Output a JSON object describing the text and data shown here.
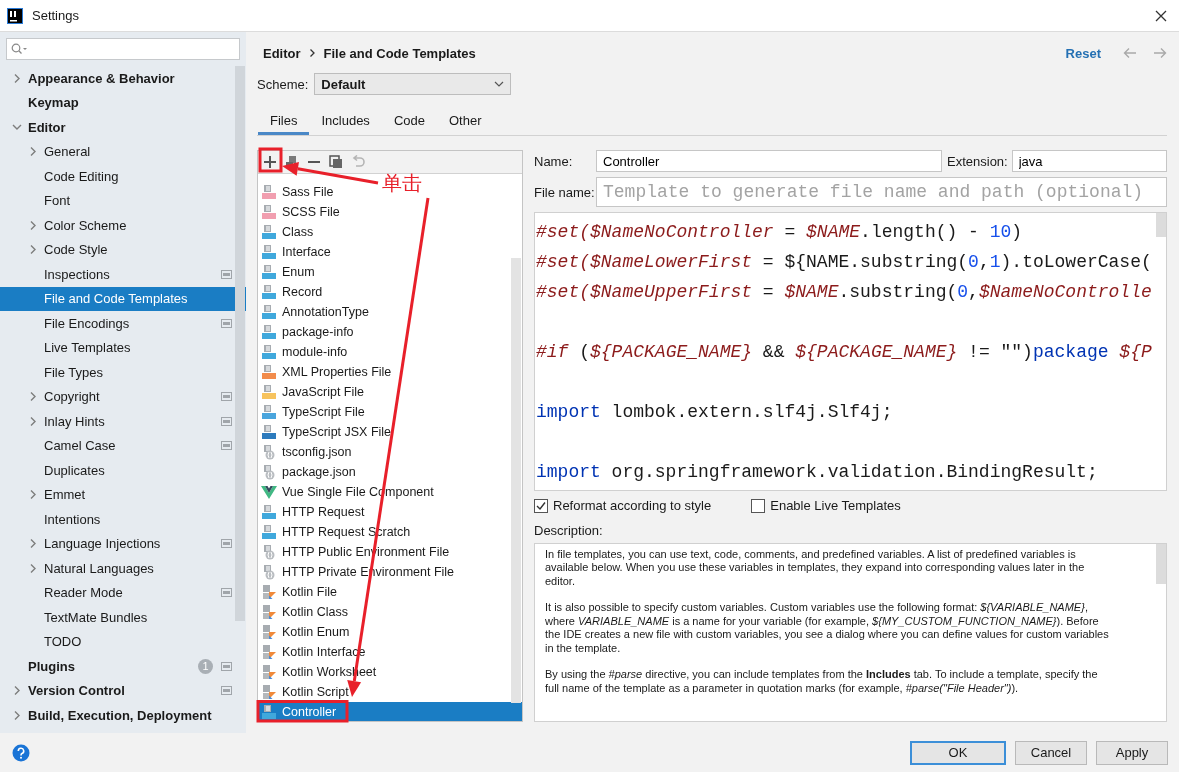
{
  "window": {
    "title": "Settings"
  },
  "sidebar": {
    "items": [
      {
        "label": "Appearance & Behavior",
        "kind": "group",
        "expanded": false,
        "selected": false
      },
      {
        "label": "Keymap",
        "kind": "leaf",
        "selected": false
      },
      {
        "label": "Editor",
        "kind": "group",
        "expanded": true,
        "selected": false,
        "children": [
          {
            "label": "General",
            "kind": "group",
            "expanded": false,
            "selected": false
          },
          {
            "label": "Code Editing",
            "kind": "leaf",
            "selected": false
          },
          {
            "label": "Font",
            "kind": "leaf",
            "selected": false
          },
          {
            "label": "Color Scheme",
            "kind": "group",
            "expanded": false,
            "selected": false
          },
          {
            "label": "Code Style",
            "kind": "group",
            "expanded": false,
            "selected": false
          },
          {
            "label": "Inspections",
            "kind": "leaf",
            "selected": false,
            "project_level": true
          },
          {
            "label": "File and Code Templates",
            "kind": "leaf",
            "selected": true
          },
          {
            "label": "File Encodings",
            "kind": "leaf",
            "selected": false,
            "project_level": true
          },
          {
            "label": "Live Templates",
            "kind": "leaf",
            "selected": false
          },
          {
            "label": "File Types",
            "kind": "leaf",
            "selected": false
          },
          {
            "label": "Copyright",
            "kind": "group",
            "expanded": false,
            "selected": false,
            "project_level": true
          },
          {
            "label": "Inlay Hints",
            "kind": "group",
            "expanded": false,
            "selected": false,
            "project_level": true
          },
          {
            "label": "Camel Case",
            "kind": "leaf",
            "selected": false,
            "project_level": true
          },
          {
            "label": "Duplicates",
            "kind": "leaf",
            "selected": false
          },
          {
            "label": "Emmet",
            "kind": "group",
            "expanded": false,
            "selected": false
          },
          {
            "label": "Intentions",
            "kind": "leaf",
            "selected": false
          },
          {
            "label": "Language Injections",
            "kind": "group",
            "expanded": false,
            "selected": false,
            "project_level": true
          },
          {
            "label": "Natural Languages",
            "kind": "group",
            "expanded": false,
            "selected": false
          },
          {
            "label": "Reader Mode",
            "kind": "leaf",
            "selected": false,
            "project_level": true
          },
          {
            "label": "TextMate Bundles",
            "kind": "leaf",
            "selected": false
          },
          {
            "label": "TODO",
            "kind": "leaf",
            "selected": false
          }
        ]
      },
      {
        "label": "Plugins",
        "kind": "leaf",
        "selected": false,
        "project_level": true,
        "badge": "1"
      },
      {
        "label": "Version Control",
        "kind": "group",
        "expanded": false,
        "selected": false,
        "project_level": true
      },
      {
        "label": "Build, Execution, Deployment",
        "kind": "group",
        "expanded": false,
        "selected": false
      }
    ]
  },
  "breadcrumb": [
    "Editor",
    "File and Code Templates"
  ],
  "reset_link": "Reset",
  "scheme": {
    "label": "Scheme:",
    "value": "Default"
  },
  "tabs": [
    {
      "label": "Files",
      "selected": true
    },
    {
      "label": "Includes",
      "selected": false
    },
    {
      "label": "Code",
      "selected": false
    },
    {
      "label": "Other",
      "selected": false
    }
  ],
  "templates": [
    {
      "name": "Sass File",
      "kind": "sass",
      "selected": false
    },
    {
      "name": "SCSS File",
      "kind": "sass",
      "selected": false
    },
    {
      "name": "Class",
      "kind": "java",
      "selected": false
    },
    {
      "name": "Interface",
      "kind": "java",
      "selected": false
    },
    {
      "name": "Enum",
      "kind": "java",
      "selected": false
    },
    {
      "name": "Record",
      "kind": "java",
      "selected": false
    },
    {
      "name": "AnnotationType",
      "kind": "java",
      "selected": false
    },
    {
      "name": "package-info",
      "kind": "java",
      "selected": false
    },
    {
      "name": "module-info",
      "kind": "java",
      "selected": false
    },
    {
      "name": "XML Properties File",
      "kind": "xml",
      "selected": false
    },
    {
      "name": "JavaScript File",
      "kind": "js",
      "selected": false
    },
    {
      "name": "TypeScript File",
      "kind": "ts",
      "selected": false
    },
    {
      "name": "TypeScript JSX File",
      "kind": "tsx",
      "selected": false
    },
    {
      "name": "tsconfig.json",
      "kind": "json",
      "selected": false
    },
    {
      "name": "package.json",
      "kind": "json",
      "selected": false
    },
    {
      "name": "Vue Single File Component",
      "kind": "vue",
      "selected": false
    },
    {
      "name": "HTTP Request",
      "kind": "api",
      "selected": false
    },
    {
      "name": "HTTP Request Scratch",
      "kind": "api",
      "selected": false
    },
    {
      "name": "HTTP Public Environment File",
      "kind": "json",
      "selected": false
    },
    {
      "name": "HTTP Private Environment File",
      "kind": "json",
      "selected": false
    },
    {
      "name": "Kotlin File",
      "kind": "kotlin",
      "selected": false
    },
    {
      "name": "Kotlin Class",
      "kind": "kotlin",
      "selected": false
    },
    {
      "name": "Kotlin Enum",
      "kind": "kotlin",
      "selected": false
    },
    {
      "name": "Kotlin Interface",
      "kind": "kotlin",
      "selected": false
    },
    {
      "name": "Kotlin Worksheet",
      "kind": "kotlin",
      "selected": false
    },
    {
      "name": "Kotlin Script",
      "kind": "kotlin",
      "selected": false
    },
    {
      "name": "Controller",
      "kind": "java",
      "selected": true
    }
  ],
  "form": {
    "name": {
      "label": "Name:",
      "value": "Controller"
    },
    "extension": {
      "label": "Extension:",
      "value": "java"
    },
    "file_name": {
      "label": "File name:",
      "placeholder": "Template to generate file name and path (optional)"
    }
  },
  "code_lines": [
    {
      "kind": "code",
      "segments": [
        {
          "kind": "directive",
          "text": "#set("
        },
        {
          "kind": "variable",
          "text": "$NameNoController"
        },
        {
          "kind": "plain",
          "text": " = "
        },
        {
          "kind": "variable",
          "text": "$NAME"
        },
        {
          "kind": "plain",
          "text": ".length() - "
        },
        {
          "kind": "number",
          "text": "10"
        },
        {
          "kind": "plain",
          "text": ")"
        }
      ]
    },
    {
      "kind": "code",
      "segments": [
        {
          "kind": "directive",
          "text": "#set("
        },
        {
          "kind": "variable",
          "text": "$NameLowerFirst"
        },
        {
          "kind": "plain",
          "text": " = ${NAME.substring("
        },
        {
          "kind": "number",
          "text": "0"
        },
        {
          "kind": "plain",
          "text": ","
        },
        {
          "kind": "number",
          "text": "1"
        },
        {
          "kind": "plain",
          "text": ").toLowerCase("
        }
      ]
    },
    {
      "kind": "code",
      "segments": [
        {
          "kind": "directive",
          "text": "#set("
        },
        {
          "kind": "variable",
          "text": "$NameUpperFirst"
        },
        {
          "kind": "plain",
          "text": " = "
        },
        {
          "kind": "variable",
          "text": "$NAME"
        },
        {
          "kind": "plain",
          "text": ".substring("
        },
        {
          "kind": "number",
          "text": "0"
        },
        {
          "kind": "plain",
          "text": ","
        },
        {
          "kind": "variable",
          "text": "$NameNoControlle"
        }
      ]
    },
    {
      "kind": "blank"
    },
    {
      "kind": "code",
      "segments": [
        {
          "kind": "directive",
          "text": "#if"
        },
        {
          "kind": "plain",
          "text": " ("
        },
        {
          "kind": "variable",
          "text": "${PACKAGE_NAME}"
        },
        {
          "kind": "plain",
          "text": " && "
        },
        {
          "kind": "variable",
          "text": "${PACKAGE_NAME}"
        },
        {
          "kind": "plain",
          "text": " != \"\")"
        },
        {
          "kind": "keyword",
          "text": "package"
        },
        {
          "kind": "variable",
          "text": " ${P"
        }
      ]
    },
    {
      "kind": "blank"
    },
    {
      "kind": "code",
      "segments": [
        {
          "kind": "keyword",
          "text": "import"
        },
        {
          "kind": "plain",
          "text": " lombok.extern.slf4j.Slf4j;"
        }
      ]
    },
    {
      "kind": "blank"
    },
    {
      "kind": "code",
      "segments": [
        {
          "kind": "keyword",
          "text": "import"
        },
        {
          "kind": "plain",
          "text": " org.springframework.validation.BindingResult;"
        }
      ]
    }
  ],
  "options": [
    {
      "label": "Reformat according to style",
      "checked": true
    },
    {
      "label": "Enable Live Templates",
      "checked": false
    }
  ],
  "description": {
    "label": "Description:",
    "paragraphs": [
      "In file templates, you can use text, code, comments, and predefined variables. A list of predefined variables is available below. When you use these variables in templates, they expand into corresponding values later in the editor.",
      "It is also possible to specify custom variables. Custom variables use the following format: *${VARIABLE_NAME}*, where *VARIABLE_NAME* is a name for your variable (for example, *${MY_CUSTOM_FUNCTION_NAME}*). Before the IDE creates a new file with custom variables, you see a dialog where you can define values for custom variables in the template.",
      "By using the *#parse* directive, you can include templates from the **Includes** tab. To include a template, specify the full name of the template as a parameter in quotation marks (for example, *#parse(\"File Header\")*)."
    ]
  },
  "buttons": [
    {
      "label": "OK",
      "kind": "default"
    },
    {
      "label": "Cancel",
      "kind": "normal"
    },
    {
      "label": "Apply",
      "kind": "normal"
    }
  ],
  "annotation": {
    "text": "单击"
  }
}
